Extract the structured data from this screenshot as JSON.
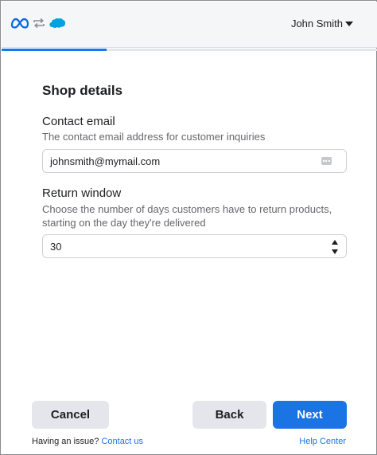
{
  "header": {
    "logos": [
      "meta-logo-icon",
      "sync-arrows-icon",
      "salesforce-logo-icon"
    ],
    "user_name": "John Smith",
    "progress_fraction": 0.28,
    "colors": {
      "accent": "#1877f2",
      "bar_bg": "#f5f6f7"
    }
  },
  "form": {
    "title": "Shop details",
    "contact_email": {
      "label": "Contact email",
      "description": "The contact email address for customer inquiries",
      "value": "johnsmith@mymail.com"
    },
    "return_window": {
      "label": "Return window",
      "description": "Choose the number of days customers have to return products, starting on the day they're delivered",
      "value": "30"
    }
  },
  "actions": {
    "cancel_label": "Cancel",
    "back_label": "Back",
    "next_label": "Next"
  },
  "footer": {
    "issue_text": "Having an issue?",
    "contact_link": "Contact us",
    "help_link": "Help Center"
  }
}
